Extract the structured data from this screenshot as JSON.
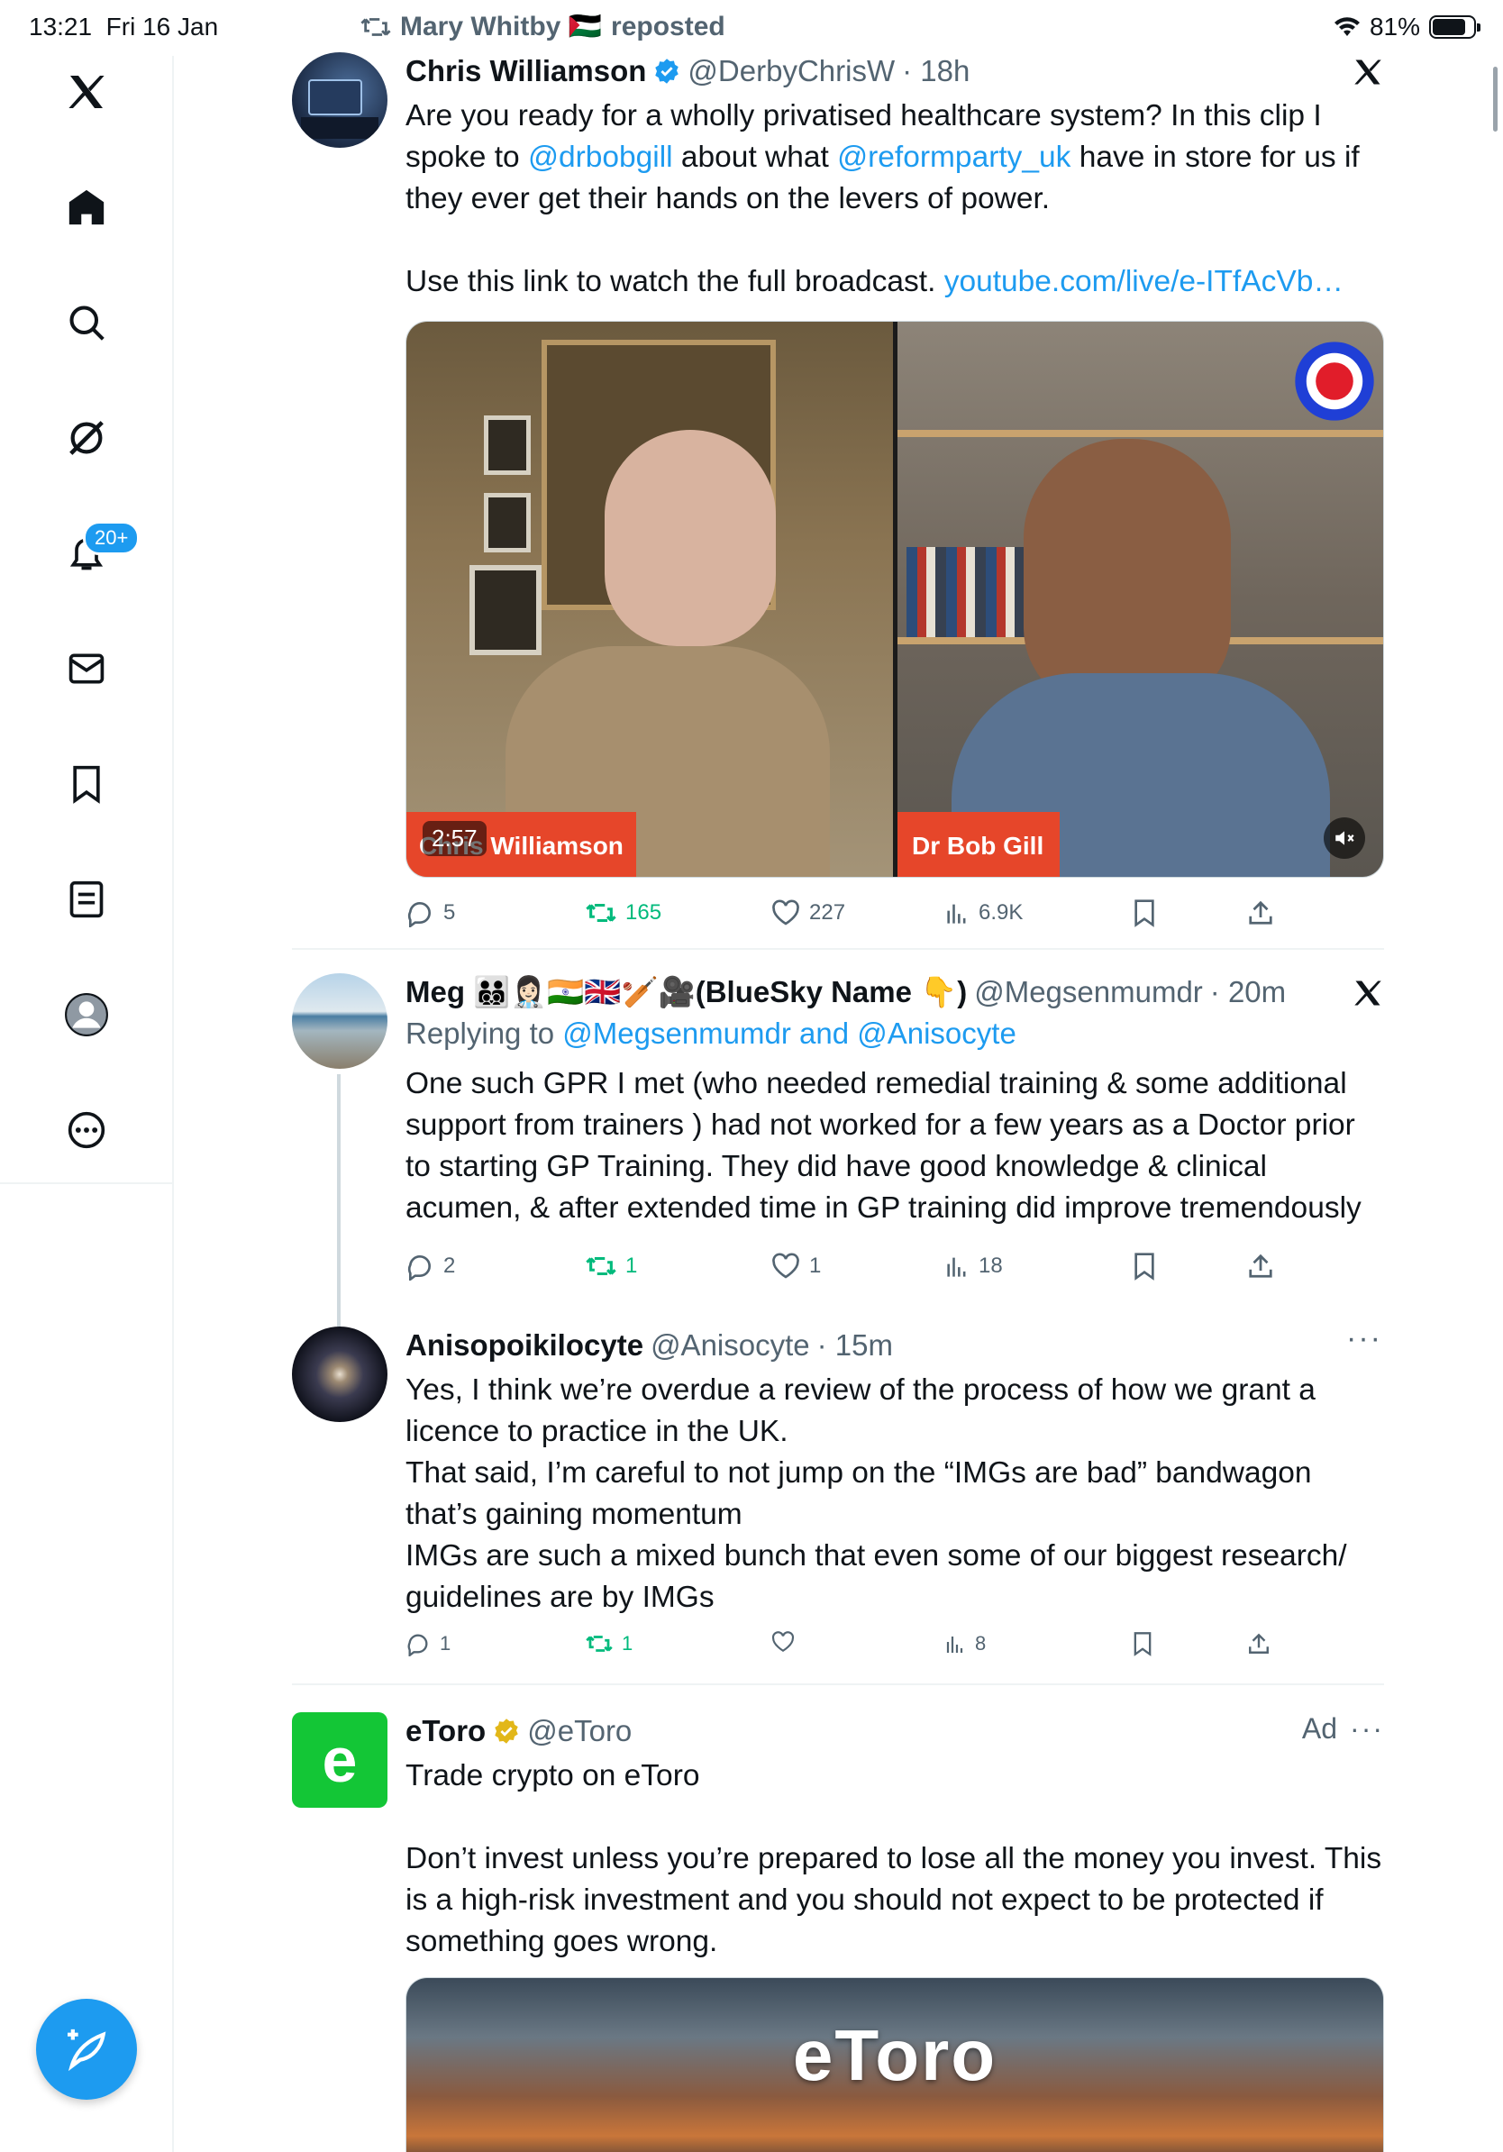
{
  "status_bar": {
    "time": "13:21",
    "date": "Fri 16 Jan",
    "battery": "81%",
    "battery_level": 0.81
  },
  "sidebar": {
    "notifications_badge": "20+",
    "items": [
      "home-icon",
      "explore-icon",
      "grok-icon",
      "notifications-icon",
      "messages-icon",
      "bookmarks-icon",
      "lists-icon",
      "profile-icon",
      "more-icon"
    ]
  },
  "repost_banner": {
    "user": "Mary Whitby 🇵🇸",
    "label": "reposted"
  },
  "tweets": [
    {
      "name": "Chris Williamson",
      "handle": "@DerbyChrisW",
      "time": "· 18h",
      "text_parts": [
        "Are you ready for a wholly privatised healthcare system? In this clip I spoke to ",
        "@drbobgill",
        " about what ",
        "@reformparty_uk",
        " have in store for us if they ever get their hands on the levers of power.",
        "Use this link to watch the full broadcast. ",
        "youtube.com/live/e-ITfAcVb…"
      ],
      "video": {
        "left_label": "Chris Williamson",
        "right_label": "Dr Bob Gill",
        "duration": "2:57"
      },
      "replies": "5",
      "reposts": "165",
      "likes": "227",
      "views": "6.9K"
    },
    {
      "name": "Meg 🧑‍🧑‍🧒‍🧒👩🏻‍⚕️🇮🇳🇬🇧🏏🎥(BlueSky Name 👇)",
      "handle": "@Megsenmumdr",
      "time": "· 20m",
      "replying_prefix": "Replying to ",
      "replying_to": "@Megsenmumdr and @Anisocyte",
      "text": "One such GPR I met (who needed remedial training & some additional support from trainers ) had not worked for a few years as a Doctor prior to starting GP Training. They did have good knowledge & clinical acumen, & after extended time in GP training did improve tremendously",
      "replies": "2",
      "reposts": "1",
      "likes": "1",
      "views": "18"
    },
    {
      "name": "Anisopoikilocyte",
      "handle": "@Anisocyte",
      "time": "· 15m",
      "text": "Yes, I think we’re overdue a review of the process of how we grant a licence to practice in the UK.\nThat said, I’m careful to not jump on the “IMGs are bad” bandwagon that’s gaining momentum\nIMGs are such a mixed bunch that even some of our biggest research/ guidelines are by IMGs",
      "replies": "1",
      "reposts": "1",
      "views": "8"
    },
    {
      "name": "eToro",
      "handle": "@eToro",
      "ad_label": "Ad",
      "text": "Trade crypto on eToro\n\nDon’t invest unless you’re prepared to lose all the money you invest. This is a high-risk investment and you should not expect to be protected if something goes wrong.",
      "image_logo": "eToro"
    }
  ],
  "colors": {
    "accent": "#1d9bf0",
    "repost_green": "#00ba7c",
    "text_secondary": "#536471",
    "etoro_green": "#13c636"
  }
}
